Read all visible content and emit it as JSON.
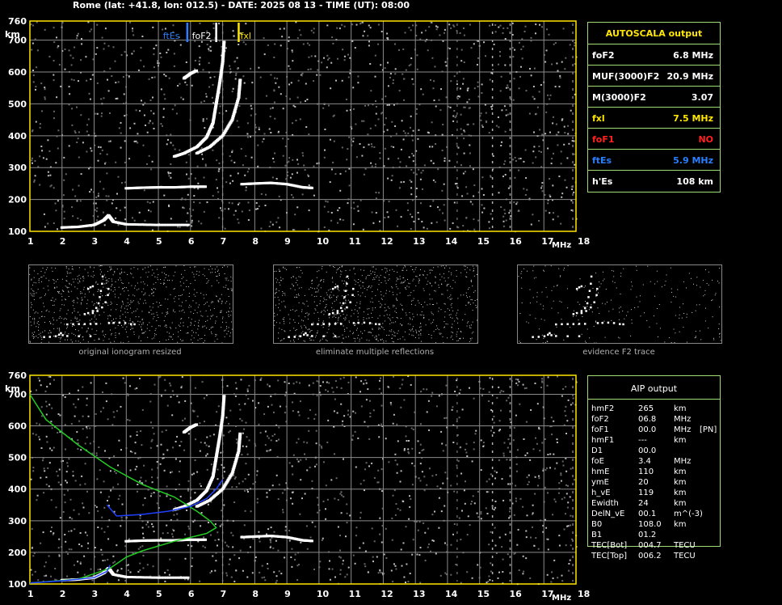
{
  "header": {
    "title": "Rome (lat: +41.8, lon: 012.5) - DATE: 2025 08 13 - TIME (UT): 08:00"
  },
  "axes": {
    "x_unit": "MHz",
    "y_unit": "km",
    "x_ticks": [
      "1",
      "2",
      "3",
      "4",
      "5",
      "6",
      "7",
      "8",
      "9",
      "10",
      "11",
      "12",
      "13",
      "14",
      "15",
      "16",
      "17",
      "18"
    ],
    "y_ticks": [
      "100",
      "200",
      "300",
      "400",
      "500",
      "600",
      "700",
      "760"
    ]
  },
  "markers": [
    {
      "label": "ftEs",
      "freq": 5.9,
      "color": "#2a7fff"
    },
    {
      "label": "foF2",
      "freq": 6.8,
      "color": "#ffffff"
    },
    {
      "label": "fxl",
      "freq": 7.5,
      "color": "#ffe600"
    }
  ],
  "autoscala": {
    "title": "AUTOSCALA output",
    "rows": [
      {
        "name": "foF2",
        "value": "6.8 MHz",
        "color": "#ffffff"
      },
      {
        "name": "MUF(3000)F2",
        "value": "20.9 MHz",
        "color": "#ffffff"
      },
      {
        "name": "M(3000)F2",
        "value": "3.07",
        "color": "#ffffff"
      },
      {
        "name": "fxl",
        "value": "7.5 MHz",
        "color": "#ffe600"
      },
      {
        "name": "foF1",
        "value": "NO",
        "color": "#ff2020"
      },
      {
        "name": "ftEs",
        "value": "5.9 MHz",
        "color": "#2a7fff"
      },
      {
        "name": "h'Es",
        "value": "108    km",
        "color": "#ffffff"
      }
    ]
  },
  "thumbnails": [
    {
      "caption": "original ionogram resized"
    },
    {
      "caption": "eliminate multiple reflections"
    },
    {
      "caption": "evidence F2 trace"
    }
  ],
  "aip": {
    "title": "AIP output",
    "rows": [
      {
        "name": "hmF2",
        "value": "265",
        "unit": "km",
        "extra": ""
      },
      {
        "name": "foF2",
        "value": "06.8",
        "unit": "MHz",
        "extra": ""
      },
      {
        "name": "foF1",
        "value": "00.0",
        "unit": "MHz",
        "extra": "[PN]"
      },
      {
        "name": "hmF1",
        "value": "---",
        "unit": "km",
        "extra": ""
      },
      {
        "name": "D1",
        "value": "00.0",
        "unit": "",
        "extra": ""
      },
      {
        "name": "foE",
        "value": "3.4",
        "unit": "MHz",
        "extra": ""
      },
      {
        "name": "hmE",
        "value": "110",
        "unit": "km",
        "extra": ""
      },
      {
        "name": "ymE",
        "value": "20",
        "unit": "km",
        "extra": ""
      },
      {
        "name": "h_vE",
        "value": "119",
        "unit": "km",
        "extra": ""
      },
      {
        "name": "Ewidth",
        "value": "24",
        "unit": "km",
        "extra": ""
      },
      {
        "name": "DelN_vE",
        "value": "00.1",
        "unit": "m^(-3)",
        "extra": ""
      },
      {
        "name": "B0",
        "value": "108.0",
        "unit": "km",
        "extra": ""
      },
      {
        "name": "B1",
        "value": "01.2",
        "unit": "",
        "extra": ""
      },
      {
        "name": "TEC[Bot]",
        "value": "004.7",
        "unit": "TECU",
        "extra": ""
      },
      {
        "name": "TEC[Top]",
        "value": "006.2",
        "unit": "TECU",
        "extra": ""
      }
    ]
  },
  "chart_data": [
    {
      "type": "scatter",
      "xlim": [
        1,
        18
      ],
      "ylim": [
        100,
        760
      ],
      "grid": true,
      "series": [
        {
          "points": [
            [
              2,
              112
            ],
            [
              2.5,
              114
            ],
            [
              3,
              120
            ],
            [
              3.3,
              135
            ],
            [
              3.45,
              150
            ],
            [
              3.6,
              130
            ],
            [
              4,
              122
            ],
            [
              5,
              120
            ],
            [
              6,
              120
            ]
          ]
        },
        {
          "points": [
            [
              5.5,
              335
            ],
            [
              5.8,
              345
            ],
            [
              6.2,
              365
            ],
            [
              6.5,
              395
            ],
            [
              6.7,
              440
            ],
            [
              6.8,
              500
            ],
            [
              6.9,
              560
            ],
            [
              7.0,
              630
            ],
            [
              7.05,
              700
            ]
          ]
        },
        {
          "points": [
            [
              6.2,
              345
            ],
            [
              6.6,
              365
            ],
            [
              7.0,
              400
            ],
            [
              7.3,
              450
            ],
            [
              7.5,
              520
            ],
            [
              7.55,
              580
            ]
          ]
        },
        {
          "points": [
            [
              5.8,
              580
            ],
            [
              6.0,
              595
            ],
            [
              6.2,
              605
            ]
          ]
        },
        {
          "points": [
            [
              4,
              235
            ],
            [
              4.5,
              237
            ],
            [
              5,
              238
            ],
            [
              5.5,
              238
            ],
            [
              6,
              240
            ],
            [
              6.5,
              240
            ]
          ]
        },
        {
          "points": [
            [
              7.6,
              248
            ],
            [
              8,
              250
            ],
            [
              8.5,
              252
            ],
            [
              9,
              248
            ],
            [
              9.5,
              238
            ],
            [
              9.8,
              236
            ]
          ]
        }
      ]
    },
    {
      "type": "line",
      "xlim": [
        1,
        18
      ],
      "ylim": [
        100,
        760
      ],
      "grid": true,
      "series": [
        {
          "color": "#22cc22",
          "points": [
            [
              1,
              700
            ],
            [
              1.5,
              620
            ],
            [
              2.5,
              540
            ],
            [
              3.5,
              470
            ],
            [
              4.5,
              415
            ],
            [
              5.5,
              375
            ],
            [
              6.2,
              330
            ],
            [
              6.6,
              300
            ],
            [
              6.8,
              278
            ],
            [
              6.5,
              260
            ],
            [
              5.5,
              235
            ],
            [
              4.5,
              205
            ],
            [
              4,
              185
            ],
            [
              3.5,
              150
            ],
            [
              2.5,
              115
            ],
            [
              1,
              103
            ]
          ]
        },
        {
          "color": "#2040ff",
          "points": [
            [
              1,
              103
            ],
            [
              2,
              110
            ],
            [
              3,
              120
            ],
            [
              3.4,
              140
            ],
            [
              3.5,
              160
            ]
          ]
        },
        {
          "color": "#2040ff",
          "points": [
            [
              3.4,
              350
            ],
            [
              3.7,
              315
            ],
            [
              4.5,
              320
            ],
            [
              5.3,
              330
            ],
            [
              6.0,
              345
            ],
            [
              6.5,
              370
            ],
            [
              6.8,
              400
            ],
            [
              7.0,
              430
            ]
          ]
        }
      ]
    }
  ]
}
